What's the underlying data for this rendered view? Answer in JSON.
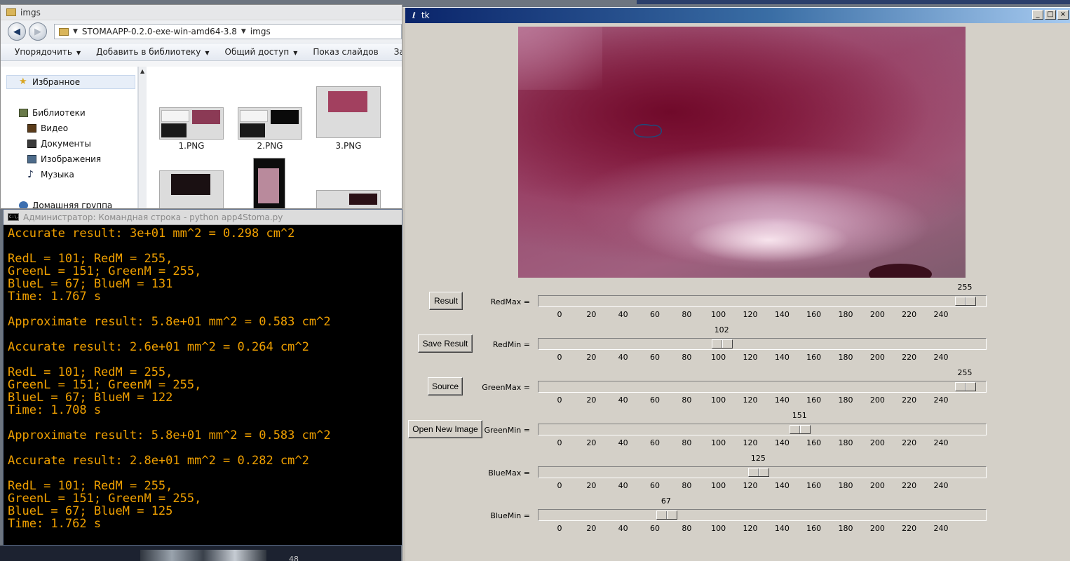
{
  "explorer": {
    "title": "imgs",
    "address": [
      "STOMAAPP-0.2.0-exe-win-amd64-3.8",
      "imgs"
    ],
    "toolbar": [
      "Упорядочить",
      "Добавить в библиотеку",
      "Общий доступ",
      "Показ слайдов",
      "Запи"
    ],
    "nav": {
      "favorites": "Избранное",
      "libraries": "Библиотеки",
      "video": "Видео",
      "documents": "Документы",
      "images": "Изображения",
      "music": "Музыка",
      "homegroup": "Домашняя группа"
    },
    "files": [
      "1.PNG",
      "2.PNG",
      "3.PNG"
    ]
  },
  "console": {
    "title": "Администратор: Командная строка - python  app4Stoma.py",
    "icon_text": "C:\\.",
    "lines": [
      "Accurate result: 3e+01 mm^2 = 0.298 cm^2",
      "",
      "RedL = 101; RedM = 255,",
      "GreenL = 151; GreenM = 255,",
      "BlueL = 67; BlueM = 131",
      "Time: 1.767 s",
      "",
      "Approximate result: 5.8e+01 mm^2 = 0.583 cm^2",
      "",
      "Accurate result: 2.6e+01 mm^2 = 0.264 cm^2",
      "",
      "RedL = 101; RedM = 255,",
      "GreenL = 151; GreenM = 255,",
      "BlueL = 67; BlueM = 122",
      "Time: 1.708 s",
      "",
      "Approximate result: 5.8e+01 mm^2 = 0.583 cm^2",
      "",
      "Accurate result: 2.8e+01 mm^2 = 0.282 cm^2",
      "",
      "RedL = 101; RedM = 255,",
      "GreenL = 151; GreenM = 255,",
      "BlueL = 67; BlueM = 125",
      "Time: 1.762 s"
    ],
    "text_color": "#f0a000"
  },
  "tk": {
    "title": "tk",
    "buttons": {
      "result": "Result",
      "save_result": "Save Result",
      "source": "Source",
      "open_new_image": "Open New Image"
    },
    "scale_ticks": [
      "0",
      "20",
      "40",
      "60",
      "80",
      "100",
      "120",
      "140",
      "160",
      "180",
      "200",
      "220",
      "240"
    ],
    "scale_max": 255,
    "scales": [
      {
        "label": "RedMax =",
        "value": 255
      },
      {
        "label": "RedMin =",
        "value": 102
      },
      {
        "label": "GreenMax =",
        "value": 255
      },
      {
        "label": "GreenMin =",
        "value": 151
      },
      {
        "label": "BlueMax =",
        "value": 125
      },
      {
        "label": "BlueMin =",
        "value": 67
      }
    ]
  },
  "desktop": {
    "taskbar_number": "48"
  }
}
